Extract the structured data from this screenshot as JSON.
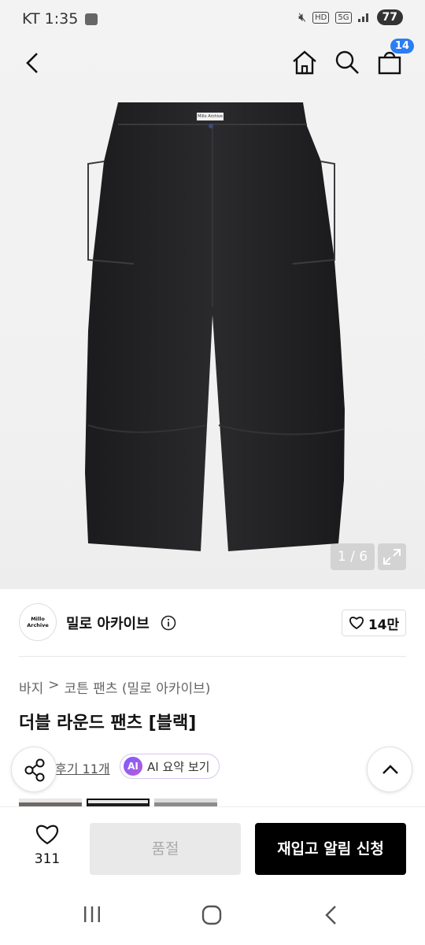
{
  "status_bar": {
    "carrier_time": "KT 1:35",
    "hd_label": "HD",
    "network_label": "5G",
    "battery": "77"
  },
  "header": {
    "cart_count": "14"
  },
  "gallery": {
    "counter": "1 / 6",
    "product_label_text": "Millo Archive"
  },
  "brand": {
    "logo_text": "Millo Archive",
    "name": "밀로 아카이브",
    "likes": "14만"
  },
  "breadcrumb": {
    "items": [
      "바지",
      "코튼 팬츠 (밀로 아카이브)"
    ],
    "separator": ">"
  },
  "product": {
    "title": "더블 라운드 팬츠 [블랙]"
  },
  "reviews": {
    "link_label": "후기 11개",
    "ai_badge": "AI",
    "ai_summary_label": "AI 요약 보기"
  },
  "action_bar": {
    "wish_count": "311",
    "soldout_label": "품절",
    "restock_label": "재입고 알림 신청"
  },
  "colors": {
    "accent_blue": "#2a7df4",
    "primary_button": "#000000",
    "disabled_button": "#e9e9e9"
  }
}
